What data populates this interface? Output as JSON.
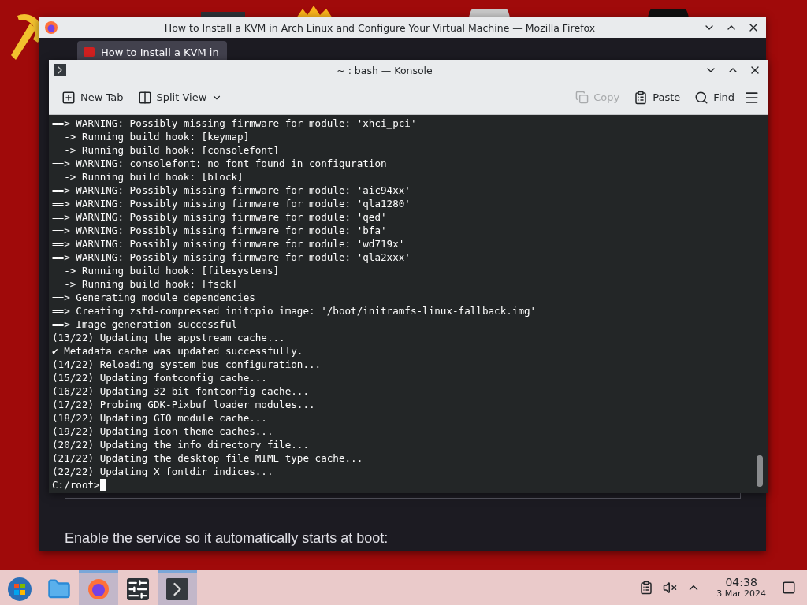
{
  "browser_window": {
    "title": "How to Install a KVM in Arch Linux and Configure Your Virtual Machine — Mozilla Firefox",
    "tab": {
      "label": "How to Install a KVM in",
      "selected": true
    },
    "page_text": "Enable the service so it automatically starts at boot:"
  },
  "terminal_window": {
    "title": "~ : bash — Konsole",
    "toolbar": [
      {
        "kind": "newtab",
        "label": "New Tab",
        "disabled": false
      },
      {
        "kind": "split",
        "label": "Split View",
        "disabled": false
      },
      {
        "kind": "spacer"
      },
      {
        "kind": "copy",
        "label": "Copy",
        "disabled": true
      },
      {
        "kind": "paste",
        "label": "Paste",
        "disabled": false
      },
      {
        "kind": "find",
        "label": "Find",
        "disabled": false
      },
      {
        "kind": "menu"
      }
    ],
    "lines": [
      "==> WARNING: Possibly missing firmware for module: 'xhci_pci'",
      "  -> Running build hook: [keymap]",
      "  -> Running build hook: [consolefont]",
      "==> WARNING: consolefont: no font found in configuration",
      "  -> Running build hook: [block]",
      "==> WARNING: Possibly missing firmware for module: 'aic94xx'",
      "==> WARNING: Possibly missing firmware for module: 'qla1280'",
      "==> WARNING: Possibly missing firmware for module: 'qed'",
      "==> WARNING: Possibly missing firmware for module: 'bfa'",
      "==> WARNING: Possibly missing firmware for module: 'wd719x'",
      "==> WARNING: Possibly missing firmware for module: 'qla2xxx'",
      "  -> Running build hook: [filesystems]",
      "  -> Running build hook: [fsck]",
      "==> Generating module dependencies",
      "==> Creating zstd-compressed initcpio image: '/boot/initramfs-linux-fallback.img'",
      "==> Image generation successful",
      "(13/22) Updating the appstream cache...",
      "✔ Metadata cache was updated successfully.",
      "(14/22) Reloading system bus configuration...",
      "(15/22) Updating fontconfig cache...",
      "(16/22) Updating 32-bit fontconfig cache...",
      "(17/22) Probing GDK-Pixbuf loader modules...",
      "(18/22) Updating GIO module cache...",
      "(19/22) Updating icon theme caches...",
      "(20/22) Updating the info directory file...",
      "(21/22) Updating the desktop file MIME type cache...",
      "(22/22) Updating X fontdir indices..."
    ],
    "prompt": "C:/root>"
  },
  "taskbar": {
    "tasks": [
      {
        "kind": "start",
        "selected": false
      },
      {
        "kind": "files",
        "selected": false
      },
      {
        "kind": "firefox",
        "selected": true
      },
      {
        "kind": "mixer",
        "selected": false
      },
      {
        "kind": "terminal",
        "selected": true
      }
    ],
    "time": "04:38",
    "date": "3 Mar 2024"
  }
}
